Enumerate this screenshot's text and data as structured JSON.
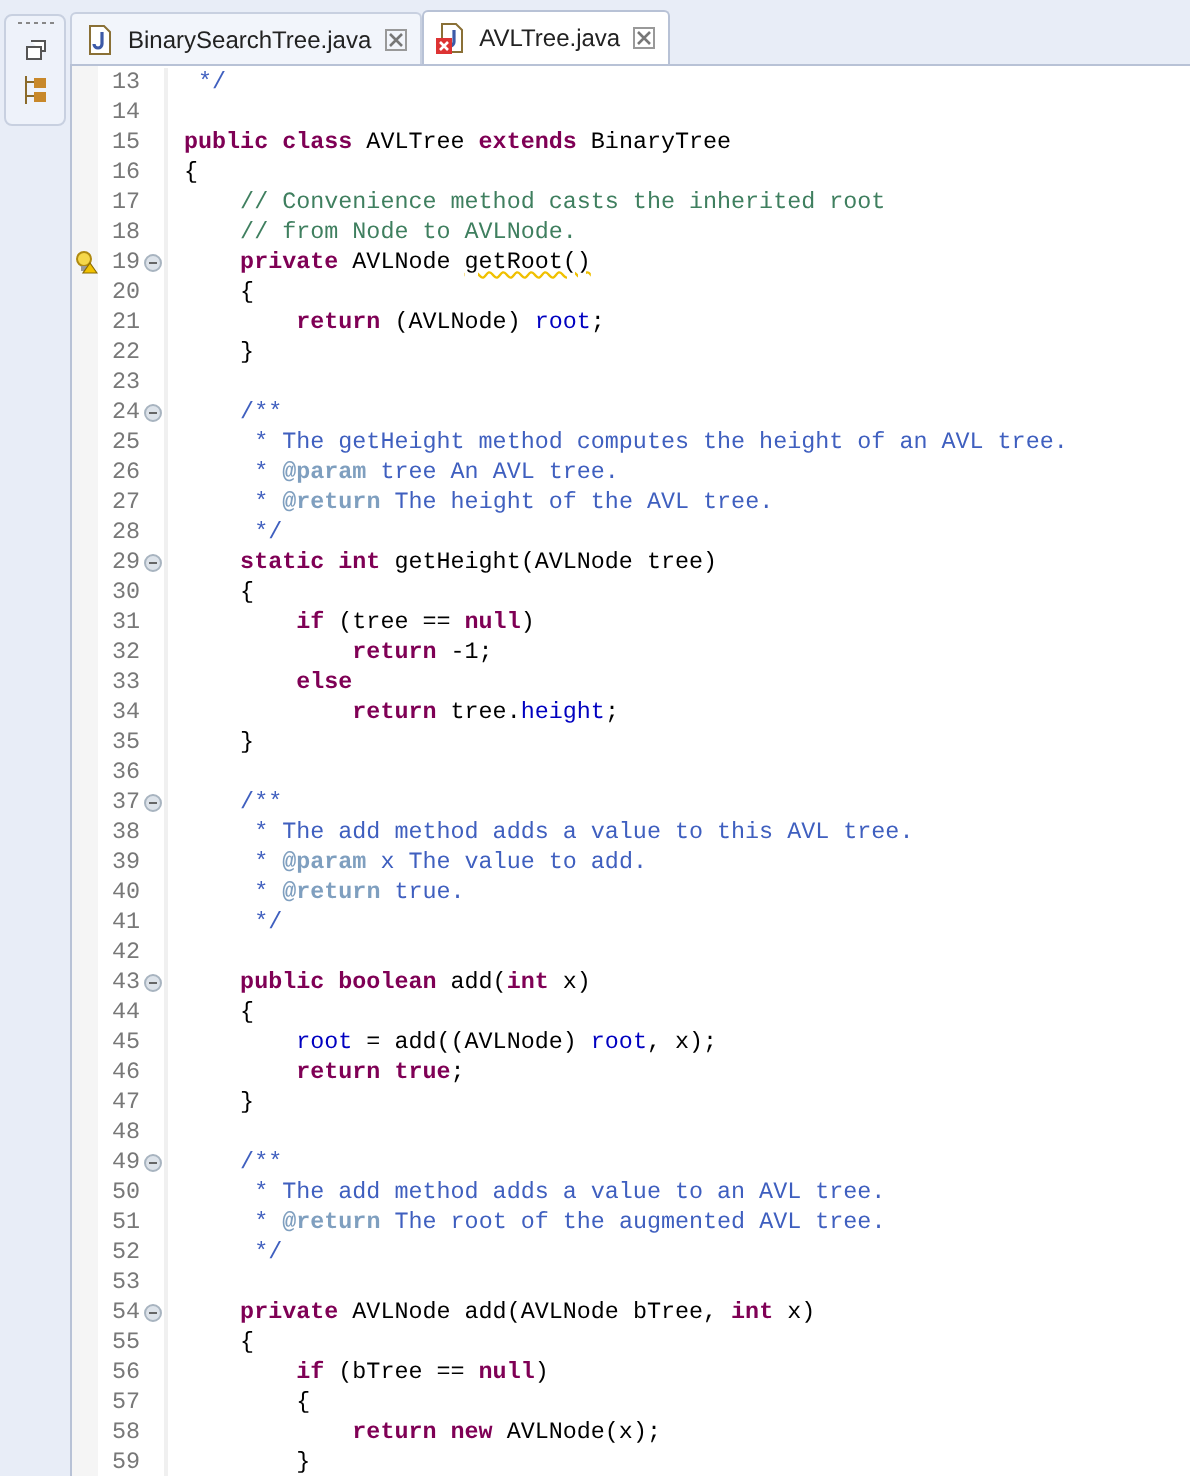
{
  "tabs": [
    {
      "label": "BinarySearchTree.java",
      "selected": false,
      "error": false
    },
    {
      "label": "AVLTree.java",
      "selected": true,
      "error": true
    }
  ],
  "lines": [
    {
      "number": "13",
      "fold": false,
      "tokens": [
        {
          "kind": "doc",
          "text": " */"
        }
      ]
    },
    {
      "number": "14",
      "fold": false
    },
    {
      "number": "15",
      "fold": false,
      "tokens": [
        {
          "kind": "kw",
          "text": "public class"
        },
        {
          "kind": "plain",
          "text": " AVLTree "
        },
        {
          "kind": "kw",
          "text": "extends"
        },
        {
          "kind": "plain",
          "text": " BinaryTree"
        }
      ]
    },
    {
      "number": "16",
      "fold": false,
      "tokens": [
        {
          "kind": "plain",
          "text": "{"
        }
      ]
    },
    {
      "number": "17",
      "fold": false,
      "tokens": [
        {
          "kind": "comment",
          "text": "    // Convenience method casts the inherited root"
        }
      ]
    },
    {
      "number": "18",
      "fold": false,
      "tokens": [
        {
          "kind": "comment",
          "text": "    // from Node to AVLNode."
        }
      ]
    },
    {
      "number": "19",
      "fold": true,
      "warning": true,
      "tokens": [
        {
          "kind": "kw",
          "text": "    private"
        },
        {
          "kind": "plain",
          "text": " AVLNode "
        },
        {
          "kind": "warn",
          "text": "getRoot()"
        }
      ]
    },
    {
      "number": "20",
      "fold": false,
      "tokens": [
        {
          "kind": "plain",
          "text": "    {"
        }
      ]
    },
    {
      "number": "21",
      "fold": false,
      "tokens": [
        {
          "kind": "kw",
          "text": "        return"
        },
        {
          "kind": "plain",
          "text": " (AVLNode) "
        },
        {
          "kind": "field",
          "text": "root"
        },
        {
          "kind": "plain",
          "text": ";"
        }
      ]
    },
    {
      "number": "22",
      "fold": false,
      "tokens": [
        {
          "kind": "plain",
          "text": "    }"
        }
      ]
    },
    {
      "number": "23",
      "fold": false
    },
    {
      "number": "24",
      "fold": true,
      "tokens": [
        {
          "kind": "doc",
          "text": "    /**"
        }
      ]
    },
    {
      "number": "25",
      "fold": false,
      "tokens": [
        {
          "kind": "doc",
          "text": "     * The getHeight method computes the height of an AVL tree."
        }
      ]
    },
    {
      "number": "26",
      "fold": false,
      "tokens": [
        {
          "kind": "doc",
          "text": "     * "
        },
        {
          "kind": "tag",
          "text": "@param"
        },
        {
          "kind": "doc",
          "text": " tree An AVL tree."
        }
      ]
    },
    {
      "number": "27",
      "fold": false,
      "tokens": [
        {
          "kind": "doc",
          "text": "     * "
        },
        {
          "kind": "tag",
          "text": "@return"
        },
        {
          "kind": "doc",
          "text": " The height of the AVL tree."
        }
      ]
    },
    {
      "number": "28",
      "fold": false,
      "tokens": [
        {
          "kind": "doc",
          "text": "     */"
        }
      ]
    },
    {
      "number": "29",
      "fold": true,
      "tokens": [
        {
          "kind": "kw",
          "text": "    static int"
        },
        {
          "kind": "plain",
          "text": " getHeight(AVLNode tree)"
        }
      ]
    },
    {
      "number": "30",
      "fold": false,
      "tokens": [
        {
          "kind": "plain",
          "text": "    {"
        }
      ]
    },
    {
      "number": "31",
      "fold": false,
      "tokens": [
        {
          "kind": "kw",
          "text": "        if"
        },
        {
          "kind": "plain",
          "text": " (tree == "
        },
        {
          "kind": "kw",
          "text": "null"
        },
        {
          "kind": "plain",
          "text": ")"
        }
      ]
    },
    {
      "number": "32",
      "fold": false,
      "tokens": [
        {
          "kind": "kw",
          "text": "            return"
        },
        {
          "kind": "plain",
          "text": " -1;"
        }
      ]
    },
    {
      "number": "33",
      "fold": false,
      "tokens": [
        {
          "kind": "kw",
          "text": "        else"
        }
      ]
    },
    {
      "number": "34",
      "fold": false,
      "tokens": [
        {
          "kind": "kw",
          "text": "            return"
        },
        {
          "kind": "plain",
          "text": " tree."
        },
        {
          "kind": "field",
          "text": "height"
        },
        {
          "kind": "plain",
          "text": ";"
        }
      ]
    },
    {
      "number": "35",
      "fold": false,
      "tokens": [
        {
          "kind": "plain",
          "text": "    }"
        }
      ]
    },
    {
      "number": "36",
      "fold": false
    },
    {
      "number": "37",
      "fold": true,
      "tokens": [
        {
          "kind": "doc",
          "text": "    /**"
        }
      ]
    },
    {
      "number": "38",
      "fold": false,
      "tokens": [
        {
          "kind": "doc",
          "text": "     * The add method adds a value to this AVL tree."
        }
      ]
    },
    {
      "number": "39",
      "fold": false,
      "tokens": [
        {
          "kind": "doc",
          "text": "     * "
        },
        {
          "kind": "tag",
          "text": "@param"
        },
        {
          "kind": "doc",
          "text": " x The value to add."
        }
      ]
    },
    {
      "number": "40",
      "fold": false,
      "tokens": [
        {
          "kind": "doc",
          "text": "     * "
        },
        {
          "kind": "tag",
          "text": "@return"
        },
        {
          "kind": "doc",
          "text": " true."
        }
      ]
    },
    {
      "number": "41",
      "fold": false,
      "tokens": [
        {
          "kind": "doc",
          "text": "     */"
        }
      ]
    },
    {
      "number": "42",
      "fold": false
    },
    {
      "number": "43",
      "fold": true,
      "tokens": [
        {
          "kind": "kw",
          "text": "    public boolean"
        },
        {
          "kind": "plain",
          "text": " add("
        },
        {
          "kind": "kw",
          "text": "int"
        },
        {
          "kind": "plain",
          "text": " x)"
        }
      ]
    },
    {
      "number": "44",
      "fold": false,
      "tokens": [
        {
          "kind": "plain",
          "text": "    {"
        }
      ]
    },
    {
      "number": "45",
      "fold": false,
      "tokens": [
        {
          "kind": "field",
          "text": "        root"
        },
        {
          "kind": "plain",
          "text": " = add((AVLNode) "
        },
        {
          "kind": "field",
          "text": "root"
        },
        {
          "kind": "plain",
          "text": ", x);"
        }
      ]
    },
    {
      "number": "46",
      "fold": false,
      "tokens": [
        {
          "kind": "kw",
          "text": "        return true"
        },
        {
          "kind": "plain",
          "text": ";"
        }
      ]
    },
    {
      "number": "47",
      "fold": false,
      "tokens": [
        {
          "kind": "plain",
          "text": "    }"
        }
      ]
    },
    {
      "number": "48",
      "fold": false
    },
    {
      "number": "49",
      "fold": true,
      "tokens": [
        {
          "kind": "doc",
          "text": "    /**"
        }
      ]
    },
    {
      "number": "50",
      "fold": false,
      "tokens": [
        {
          "kind": "doc",
          "text": "     * The add method adds a value to an AVL tree."
        }
      ]
    },
    {
      "number": "51",
      "fold": false,
      "tokens": [
        {
          "kind": "doc",
          "text": "     * "
        },
        {
          "kind": "tag",
          "text": "@return"
        },
        {
          "kind": "doc",
          "text": " The root of the augmented AVL tree."
        }
      ]
    },
    {
      "number": "52",
      "fold": false,
      "tokens": [
        {
          "kind": "doc",
          "text": "     */"
        }
      ]
    },
    {
      "number": "53",
      "fold": false
    },
    {
      "number": "54",
      "fold": true,
      "tokens": [
        {
          "kind": "kw",
          "text": "    private"
        },
        {
          "kind": "plain",
          "text": " AVLNode add(AVLNode bTree, "
        },
        {
          "kind": "kw",
          "text": "int"
        },
        {
          "kind": "plain",
          "text": " x)"
        }
      ]
    },
    {
      "number": "55",
      "fold": false,
      "tokens": [
        {
          "kind": "plain",
          "text": "    {"
        }
      ]
    },
    {
      "number": "56",
      "fold": false,
      "tokens": [
        {
          "kind": "kw",
          "text": "        if"
        },
        {
          "kind": "plain",
          "text": " (bTree == "
        },
        {
          "kind": "kw",
          "text": "null"
        },
        {
          "kind": "plain",
          "text": ")"
        }
      ]
    },
    {
      "number": "57",
      "fold": false,
      "tokens": [
        {
          "kind": "plain",
          "text": "        {"
        }
      ]
    },
    {
      "number": "58",
      "fold": false,
      "tokens": [
        {
          "kind": "kw",
          "text": "            return new"
        },
        {
          "kind": "plain",
          "text": " AVLNode(x);"
        }
      ]
    },
    {
      "number": "59",
      "fold": false,
      "tokens": [
        {
          "kind": "plain",
          "text": "        }"
        }
      ]
    }
  ]
}
